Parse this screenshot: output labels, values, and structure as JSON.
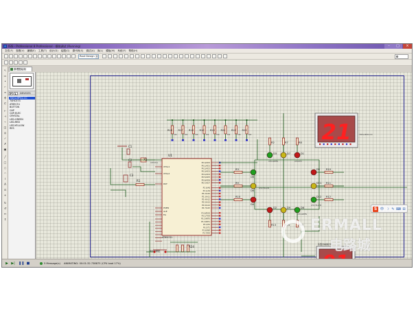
{
  "window": {
    "title": "ISIS - Professional 8 Professional - 模拟调试 (Running)"
  },
  "menu": [
    "文件(F)",
    "查看(V)",
    "编辑(E)",
    "工具(T)",
    "设计(D)",
    "绘图(G)",
    "源代码(S)",
    "调试(A)",
    "库(L)",
    "模板(M)",
    "系统(Y)",
    "帮助(H)"
  ],
  "toolbar": {
    "design_select": "Root Design"
  },
  "tab": {
    "label": "原理图绘制"
  },
  "device_panel": {
    "pick_button": "P",
    "lib_button": "L",
    "header": "DEVICES",
    "items": [
      "7SEG-MPX2-CC",
      "74HC573",
      "AT89C51",
      "BUTTON",
      "CAP",
      "CAP-ELEC",
      "CRYSTAL",
      "LED-GREEN",
      "LED-RED",
      "LED-YELLOW",
      "RES"
    ],
    "selected_index": 0
  },
  "schematic": {
    "mcu_ref": "U1",
    "mcu_name": "AT89C51",
    "mcu_left_pins": [
      "XTAL1",
      "XTAL2",
      "RST",
      "PSEN",
      "ALE",
      "EA"
    ],
    "mcu_right_pins": [
      "P0.0/AD0",
      "P0.1/AD1",
      "P0.2/AD2",
      "P0.3/AD3",
      "P0.4/AD4",
      "P0.5/AD5",
      "P0.6/AD6",
      "P0.7/AD7",
      "P2.0/A8",
      "P2.1/A9",
      "P2.2/A10",
      "P2.3/A11",
      "P2.4/A12",
      "P2.5/A13",
      "P2.6/A14",
      "P2.7/A15",
      "P3.0/RXD",
      "P3.1/TXD",
      "P3.2/INT0",
      "P3.3/INT1",
      "P3.4/T0",
      "P3.5/T1",
      "P3.6/WR",
      "P3.7/RD"
    ],
    "mcu_bottom_pins": [
      "P1.0",
      "P1.1",
      "P1.2",
      "P1.3",
      "P1.4",
      "P1.5",
      "P1.6",
      "P1.7"
    ],
    "resistor_bank_top": [
      "R16",
      "R17",
      "R18",
      "R19",
      "R20",
      "R21",
      "R22",
      "R23"
    ],
    "bank_value": "10k",
    "crystal": "X1",
    "crystal_type": "CRYSTAL",
    "caps": [
      "C1",
      "C2",
      "C3"
    ],
    "reset_resistor": "R1",
    "bottom_bank_ref": "R24",
    "buttons_caption": "紧急时按钮",
    "resistors_left": [
      "R3",
      "R9",
      "R10"
    ],
    "resistors_right": [
      "R10",
      "R11",
      "R12"
    ],
    "resistors_top": [
      "R2",
      "R7",
      "R8"
    ],
    "resistors_bottom": [
      "R13",
      "R14",
      "R15"
    ],
    "leds_top": [
      "D3",
      "D7",
      "D1"
    ],
    "leds_left": [
      "D8",
      "D6",
      "D4"
    ],
    "leds_right": [
      "D5",
      "D11",
      "D12"
    ],
    "leds_bottom": [
      "D2",
      "D9",
      "D6"
    ],
    "led_labels": [
      "LED-GREEN",
      "LED-YELLOW",
      "LED-RED"
    ],
    "display_top_value": "21",
    "display_bottom_value": "91",
    "display_bottom_caption": "东西方向倒计时",
    "display_part": "7SEG-MPX2-CC"
  },
  "status": {
    "message_count": "5 Message(s)",
    "text": "ANIMATING: 00:01:32.738875 (CPU load 17%)"
  },
  "watermark": {
    "text": "ERMALL",
    "sub": "电路城"
  },
  "floating_widget": {
    "logo": "S",
    "icons": [
      "中",
      "☽",
      "✎",
      "⌨",
      "⊞"
    ]
  },
  "colors": {
    "title_bar": "#7a5cb8",
    "canvas": "#e8e8dc",
    "sheet_border": "#1e1e8a",
    "wire": "#1f5c1f",
    "component": "#8a1a1a",
    "seven_seg_bg": "#a84a4a",
    "seven_seg_on": "#ff2020",
    "led_red": "#c01818",
    "led_green": "#1e9e1e",
    "led_yellow": "#c8b818",
    "selection": "#1f4fd0"
  }
}
